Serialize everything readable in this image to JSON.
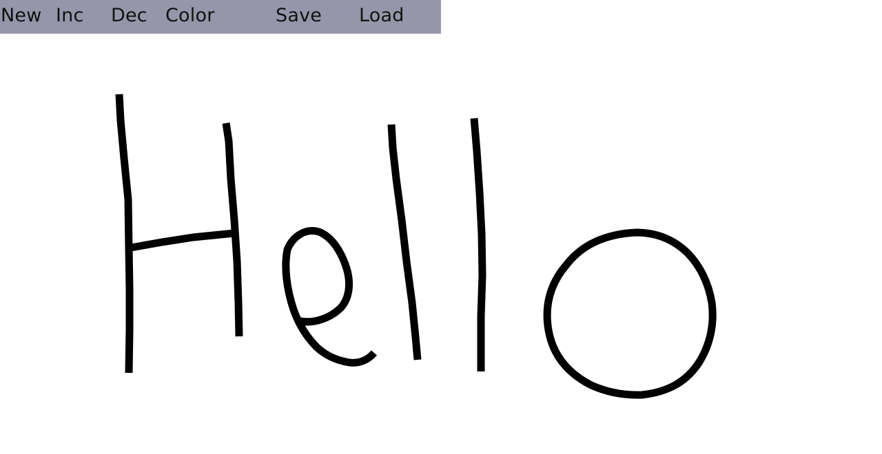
{
  "toolbar": {
    "new_label": "New",
    "inc_label": "Inc",
    "dec_label": "Dec",
    "color_label": "Color",
    "save_label": "Save",
    "load_label": "Load",
    "background": "#9696aa"
  },
  "canvas": {
    "background": "#ffffff",
    "stroke_color": "#000000",
    "drawn_text": "Hello"
  }
}
